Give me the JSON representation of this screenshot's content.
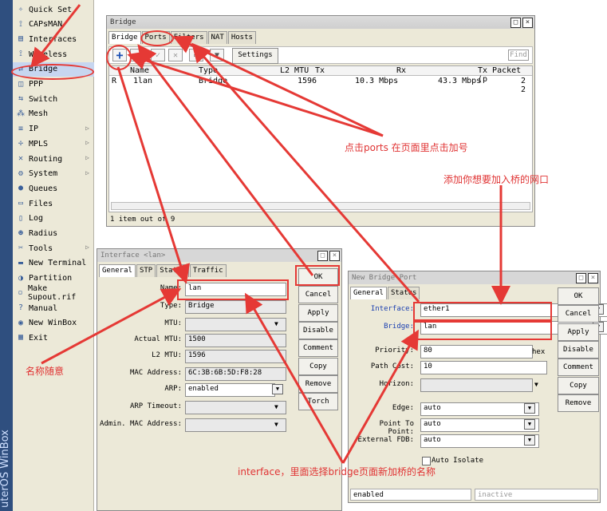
{
  "brand_text": "uterOS WinBox",
  "menu": {
    "items": [
      {
        "label": "Quick Set",
        "icon": "wand-icon"
      },
      {
        "label": "CAPsMAN",
        "icon": "antenna-icon"
      },
      {
        "label": "Interfaces",
        "icon": "interfaces-icon"
      },
      {
        "label": "Wireless",
        "icon": "antenna-icon"
      },
      {
        "label": "Bridge",
        "icon": "bridge-icon"
      },
      {
        "label": "PPP",
        "icon": "ppp-icon"
      },
      {
        "label": "Switch",
        "icon": "switch-icon"
      },
      {
        "label": "Mesh",
        "icon": "mesh-icon"
      },
      {
        "label": "IP",
        "icon": "ip-icon",
        "submenu": true
      },
      {
        "label": "MPLS",
        "icon": "mpls-icon",
        "submenu": true
      },
      {
        "label": "Routing",
        "icon": "routing-icon",
        "submenu": true
      },
      {
        "label": "System",
        "icon": "gear-icon",
        "submenu": true
      },
      {
        "label": "Queues",
        "icon": "queues-icon"
      },
      {
        "label": "Files",
        "icon": "folder-icon"
      },
      {
        "label": "Log",
        "icon": "log-icon"
      },
      {
        "label": "Radius",
        "icon": "radius-icon"
      },
      {
        "label": "Tools",
        "icon": "tools-icon",
        "submenu": true
      },
      {
        "label": "New Terminal",
        "icon": "terminal-icon"
      },
      {
        "label": "Partition",
        "icon": "partition-icon"
      },
      {
        "label": "Make Supout.rif",
        "icon": "document-icon"
      },
      {
        "label": "Manual",
        "icon": "help-icon"
      },
      {
        "label": "New WinBox",
        "icon": "globe-icon"
      },
      {
        "label": "Exit",
        "icon": "exit-icon"
      }
    ]
  },
  "bridge_window": {
    "title": "Bridge",
    "tabs": [
      "Bridge",
      "Ports",
      "Filters",
      "NAT",
      "Hosts"
    ],
    "settings_label": "Settings",
    "find_placeholder": "Find",
    "columns": [
      "Name",
      "Type",
      "L2 MTU",
      "Tx",
      "Rx",
      "Tx Packet (p"
    ],
    "rows": [
      {
        "flag": "R",
        "name": "1lan",
        "type": "Bridge",
        "l2mtu": "1596",
        "tx": "10.3 Mbps",
        "rx": "43.3 Mbps",
        "txp": "2 2"
      }
    ],
    "status": "1 item out of 9"
  },
  "interface_window": {
    "title": "Interface <lan>",
    "tabs": [
      "General",
      "STP",
      "Status",
      "Traffic"
    ],
    "fields": {
      "name_label": "Name:",
      "name_value": "lan",
      "type_label": "Type:",
      "type_value": "Bridge",
      "mtu_label": "MTU:",
      "mtu_value": "",
      "actual_mtu_label": "Actual MTU:",
      "actual_mtu_value": "1500",
      "l2mtu_label": "L2 MTU:",
      "l2mtu_value": "1596",
      "mac_label": "MAC Address:",
      "mac_value": "6C:3B:6B:5D:F8:28",
      "arp_label": "ARP:",
      "arp_value": "enabled",
      "arp_timeout_label": "ARP Timeout:",
      "arp_timeout_value": "",
      "admin_mac_label": "Admin. MAC Address:",
      "admin_mac_value": ""
    },
    "buttons": [
      "OK",
      "Cancel",
      "Apply",
      "Disable",
      "Comment",
      "Copy",
      "Remove",
      "Torch"
    ]
  },
  "port_window": {
    "title": "New Bridge Port",
    "tabs": [
      "General",
      "Status"
    ],
    "fields": {
      "interface_label": "Interface:",
      "interface_value": "ether1",
      "bridge_label": "Bridge:",
      "bridge_value": "lan",
      "priority_label": "Priority:",
      "priority_value": "80",
      "priority_unit": "hex",
      "path_cost_label": "Path Cost:",
      "path_cost_value": "10",
      "horizon_label": "Horizon:",
      "horizon_value": "",
      "edge_label": "Edge:",
      "edge_value": "auto",
      "p2p_label": "Point To Point:",
      "p2p_value": "auto",
      "ext_fdb_label": "External FDB:",
      "ext_fdb_value": "auto",
      "auto_isolate_label": "Auto Isolate"
    },
    "buttons": [
      "OK",
      "Cancel",
      "Apply",
      "Disable",
      "Comment",
      "Copy",
      "Remove"
    ],
    "status_left": "enabled",
    "status_right": "inactive"
  },
  "annotations": {
    "ports_hint": "点击ports 在页面里点击加号",
    "add_hint": "添加你想要加入桥的网口",
    "name_hint": "名称随意",
    "interface_hint": "interface，里面选择bridge页面新加桥的名称"
  },
  "colors": {
    "annotation": "#e03434",
    "menu_bg": "#ece9d8",
    "selected": "#c7d6f0",
    "brand_strip": "#2f4f7f"
  }
}
